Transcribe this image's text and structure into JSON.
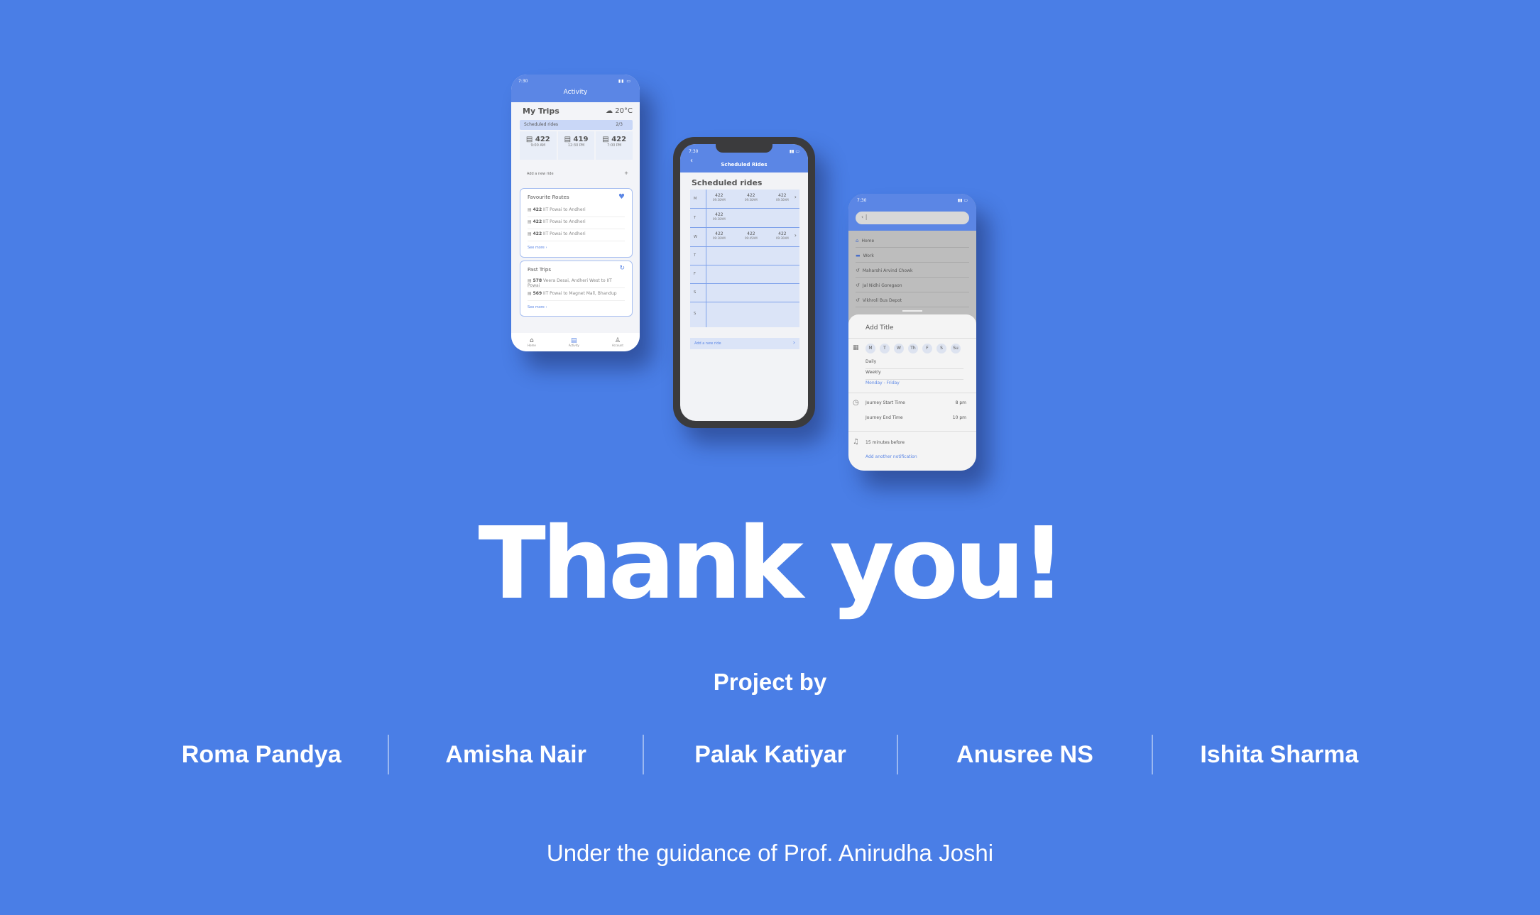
{
  "colors": {
    "background": "#4a7ee6",
    "accent": "#5b86e5",
    "text": "#ffffff"
  },
  "phone1": {
    "status_time": "7:30",
    "title": "Activity",
    "my_trips": "My Trips",
    "temperature": "20°C",
    "scheduled_label": "Scheduled rides",
    "scheduled_count": "2/3",
    "rides": [
      {
        "num": "422",
        "time": "9:00 AM"
      },
      {
        "num": "419",
        "time": "12:30 PM"
      },
      {
        "num": "422",
        "time": "7:00 PM"
      }
    ],
    "add_ride": "Add a new ride",
    "fav_title": "Favourite Routes",
    "fav_routes": [
      {
        "num": "422",
        "route": "IIT Powai to Andheri"
      },
      {
        "num": "422",
        "route": "IIT Powai to Andheri"
      },
      {
        "num": "422",
        "route": "IIT Powai to Andheri"
      }
    ],
    "see_more": "See more",
    "past_title": "Past Trips",
    "past_trips": [
      {
        "num": "578",
        "route": "Veera Desai, Andheri West to IIT Powai"
      },
      {
        "num": "569",
        "route": "IIT Powai to Magnet Mall, Bhandup"
      }
    ],
    "tabs": [
      "Home",
      "Activity",
      "Account"
    ]
  },
  "phone2": {
    "status_time": "7:30",
    "title": "Scheduled Rides",
    "heading": "Scheduled rides",
    "days": [
      "M",
      "T",
      "W",
      "T",
      "F",
      "S",
      "S"
    ],
    "monday": [
      {
        "num": "422",
        "time": "09:30AM"
      },
      {
        "num": "422",
        "time": "09:30AM"
      },
      {
        "num": "422",
        "time": "09:30AM"
      }
    ],
    "tuesday": [
      {
        "num": "422",
        "time": "09:30AM"
      }
    ],
    "wednesday": [
      {
        "num": "422",
        "time": "09:30AM"
      },
      {
        "num": "422",
        "time": "09:45AM"
      },
      {
        "num": "422",
        "time": "09:30AM"
      }
    ],
    "add_new": "Add a new ride"
  },
  "phone3": {
    "status_time": "7:30",
    "locations": [
      "Home",
      "Work",
      "Maharshi Arvind Chowk",
      "Jal Nidhi Goregaon",
      "Vikhroli Bus Depot"
    ],
    "add_title": "Add Title",
    "week_days": [
      "M",
      "T",
      "W",
      "Th",
      "F",
      "S",
      "Su"
    ],
    "options": [
      "Daily",
      "Weekly",
      "Monday - Friday"
    ],
    "start_label": "Journey Start Time",
    "start_value": "8 pm",
    "end_label": "Journey End Time",
    "end_value": "10 pm",
    "notification": "15 minutes before",
    "add_notification": "Add another notification"
  },
  "thanks": "Thank you!",
  "project_by": "Project by",
  "members": [
    "Roma Pandya",
    "Amisha Nair",
    "Palak Katiyar",
    "Anusree NS",
    "Ishita Sharma"
  ],
  "guidance": "Under the guidance of Prof. Anirudha Joshi"
}
